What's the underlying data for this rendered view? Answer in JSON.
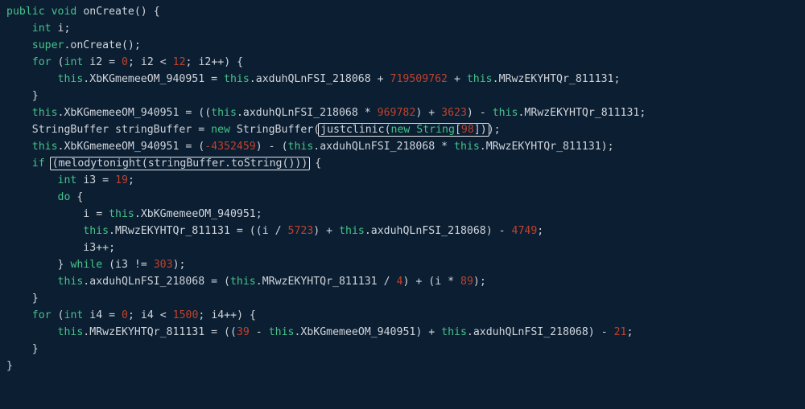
{
  "tokens": {
    "kw_public": "public",
    "kw_void": "void",
    "kw_int": "int",
    "kw_super": "super",
    "kw_for": "for",
    "kw_if": "if",
    "kw_do": "do",
    "kw_while": "while",
    "kw_this": "this",
    "kw_new": "new",
    "kw_String": "String",
    "method_onCreate": "onCreate",
    "method_toString": "toString",
    "id_i": "i",
    "id_i2": "i2",
    "id_i3": "i3",
    "id_i4": "i4",
    "id_StringBuffer": "StringBuffer",
    "id_stringBuffer": "stringBuffer",
    "id_justclinic": "justclinic",
    "id_melodytonight": "melodytonight",
    "fld_XbKG": "XbKGmemeeOM_940951",
    "fld_axd": "axduhQLnFSI_218068",
    "fld_MRw": "MRwzEKYHTQr_811131",
    "num_0": "0",
    "num_12": "12",
    "num_719509762": "719509762",
    "num_969782": "969782",
    "num_3623": "3623",
    "num_m4352459": "-4352459",
    "num_98": "98",
    "num_19": "19",
    "num_5723": "5723",
    "num_4749": "4749",
    "num_303": "303",
    "num_4": "4",
    "num_89": "89",
    "num_1500": "1500",
    "num_39": "39",
    "num_21": "21"
  },
  "punct": {
    "open_paren": "(",
    "close_paren": ")",
    "open_brace": "{",
    "close_brace": "}",
    "open_bracket": "[",
    "close_bracket": "]",
    "semicolon": ";",
    "comma": ",",
    "dot": ".",
    "eq": "=",
    "plus": "+",
    "minus": "-",
    "star": "*",
    "slash": "/",
    "lt": "<",
    "ne": "!=",
    "inc": "++"
  },
  "boxes": {
    "box1_label": "justclinic-call",
    "box2_label": "melodytonight-condition"
  }
}
